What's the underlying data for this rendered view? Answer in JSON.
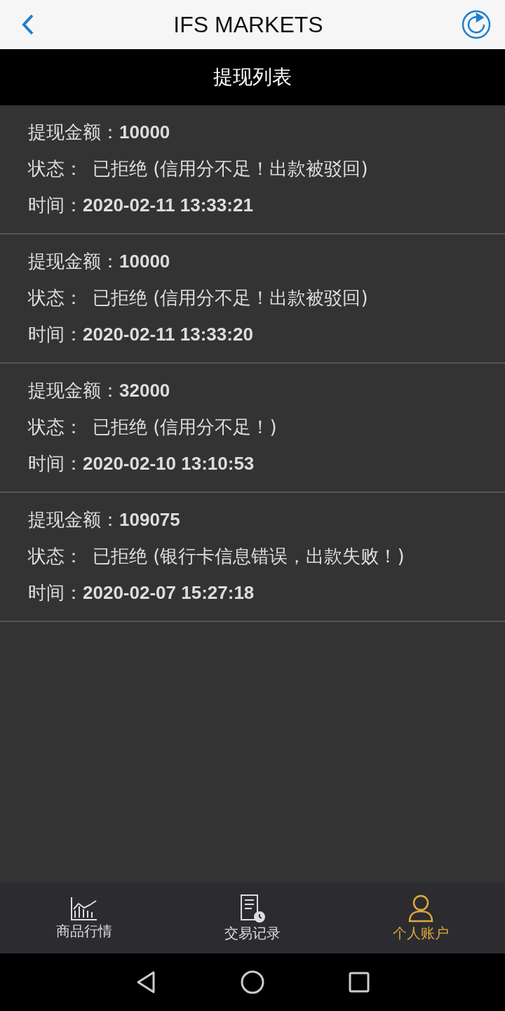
{
  "header": {
    "title": "IFS MARKETS"
  },
  "subheader": {
    "title": "提现列表"
  },
  "records": [
    {
      "amount_label": "提现金额：",
      "amount": "10000",
      "status_label": "状态：",
      "status": "已拒绝 (信用分不足！出款被驳回)",
      "time_label": "时间：",
      "time": "2020-02-11 13:33:21"
    },
    {
      "amount_label": "提现金额：",
      "amount": "10000",
      "status_label": "状态：",
      "status": "已拒绝 (信用分不足！出款被驳回)",
      "time_label": "时间：",
      "time": "2020-02-11 13:33:20"
    },
    {
      "amount_label": "提现金额：",
      "amount": "32000",
      "status_label": "状态：",
      "status": "已拒绝 (信用分不足！)",
      "time_label": "时间：",
      "time": "2020-02-10 13:10:53"
    },
    {
      "amount_label": "提现金额：",
      "amount": "109075",
      "status_label": "状态：",
      "status": "已拒绝 (银行卡信息错误，出款失败！)",
      "time_label": "时间：",
      "time": "2020-02-07 15:27:18"
    }
  ],
  "tabs": [
    {
      "kind": "chart",
      "label": "商品行情",
      "selected": false
    },
    {
      "kind": "records",
      "label": "交易记录",
      "selected": false
    },
    {
      "kind": "account",
      "label": "个人账户",
      "selected": true
    }
  ]
}
